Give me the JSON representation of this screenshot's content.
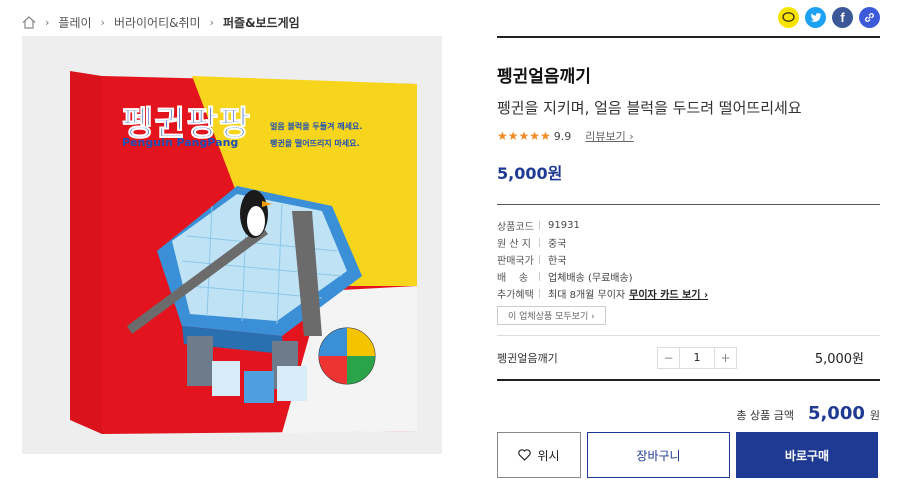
{
  "breadcrumb": {
    "items": [
      "플레이",
      "버라이어티&취미",
      "퍼즐&보드게임"
    ]
  },
  "share": {
    "icons": [
      "kakaotalk-icon",
      "twitter-icon",
      "facebook-icon",
      "link-icon"
    ],
    "colors": [
      "#f7e300",
      "#1da1f2",
      "#3b5998",
      "#3d5bd9"
    ]
  },
  "product": {
    "box_title": "펭귄팡팡",
    "box_title_en": "Penguin PangPang",
    "box_text_1": "얼음 블럭을 두들겨 깨세요.",
    "box_text_2": "펭귄을 떨어뜨리지 마세요."
  },
  "info": {
    "title": "펭귄얼음깨기",
    "subtitle": "펭귄을 지키며, 얼음 블럭을 두드려 떨어뜨리세요",
    "stars": "★★★★★",
    "rating": 4.5,
    "score": "9.9",
    "review_link": "리뷰보기 ›",
    "price": "5,000원"
  },
  "specs": [
    {
      "label": "상품코드",
      "value": "91931"
    },
    {
      "label": "원 산 지",
      "value": "중국"
    },
    {
      "label": "판매국가",
      "value": "한국"
    },
    {
      "label": "배    송",
      "value": "업체배송 (무료배송)"
    },
    {
      "label": "추가혜택",
      "value": "최대 8개월 무이자",
      "link": "무이자 카드 보기 ›"
    }
  ],
  "seller_button": "이 업체상품 모두보기 ›",
  "option": {
    "name": "펭귄얼음깨기",
    "minus": "−",
    "qty": "1",
    "plus": "+",
    "price": "5,000원"
  },
  "total": {
    "label": "총 상품 금액",
    "value": "5,000",
    "unit": "원"
  },
  "actions": {
    "wish": "위시",
    "cart": "장바구니",
    "buy": "바로구매"
  },
  "colors": {
    "accent": "#1f3a93",
    "star": "#f08a24"
  }
}
